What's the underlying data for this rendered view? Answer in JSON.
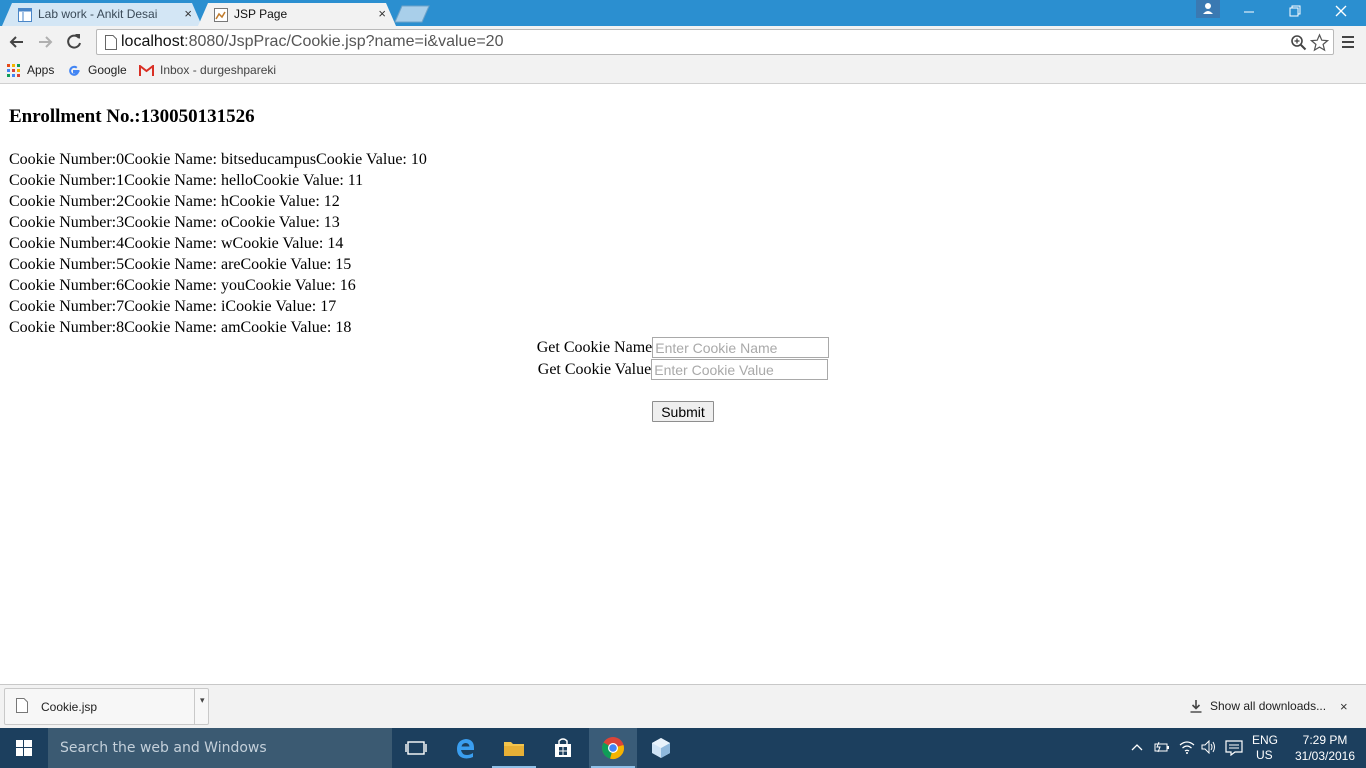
{
  "browser": {
    "tabs": [
      {
        "title": "Lab work - Ankit Desai",
        "close": "×"
      },
      {
        "title": "JSP Page",
        "close": "×"
      }
    ],
    "url_host": "localhost",
    "url_path": ":8080/JspPrac/Cookie.jsp?name=i&value=20",
    "bookmarks": [
      {
        "label": "Apps",
        "icon": "apps-grid-icon"
      },
      {
        "label": "Google",
        "icon": "google-g-icon"
      },
      {
        "label": "Inbox - durgeshpareki",
        "icon": "gmail-icon"
      }
    ]
  },
  "page": {
    "enrollment": "Enrollment No.:130050131526",
    "cookies": [
      "Cookie Number:0Cookie Name: bitseducampusCookie Value: 10",
      "Cookie Number:1Cookie Name: helloCookie Value: 11",
      "Cookie Number:2Cookie Name: hCookie Value: 12",
      "Cookie Number:3Cookie Name: oCookie Value: 13",
      "Cookie Number:4Cookie Name: wCookie Value: 14",
      "Cookie Number:5Cookie Name: areCookie Value: 15",
      "Cookie Number:6Cookie Name: youCookie Value: 16",
      "Cookie Number:7Cookie Name: iCookie Value: 17",
      "Cookie Number:8Cookie Name: amCookie Value: 18"
    ],
    "form": {
      "name_label": "Get Cookie Name",
      "name_placeholder": "Enter Cookie Name",
      "name_value": "",
      "value_label": "Get Cookie Value",
      "value_placeholder": "Enter Cookie Value",
      "value_value": "",
      "submit_label": "Submit"
    }
  },
  "downloads": {
    "file_name": "Cookie.jsp",
    "show_all": "Show all downloads...",
    "close": "×"
  },
  "taskbar": {
    "search_placeholder": "Search the web and Windows",
    "lang_line1": "ENG",
    "lang_line2": "US",
    "time": "7:29 PM",
    "date": "31/03/2016"
  },
  "colors": {
    "titlebar": "#2b8fd0",
    "toolbar": "#f2f2f2",
    "taskbar": "#1c3f5e",
    "taskbar_search": "#3b5a72"
  }
}
